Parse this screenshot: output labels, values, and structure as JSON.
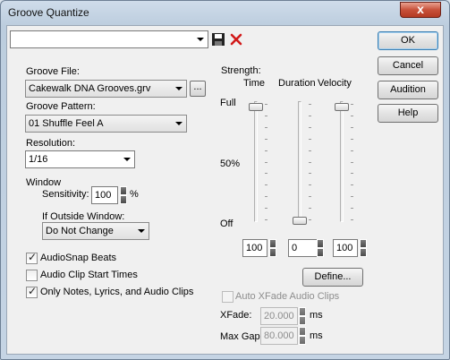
{
  "window": {
    "title": "Groove Quantize",
    "close_glyph": "x"
  },
  "preset": {
    "value": "",
    "save_icon": "save-icon",
    "delete_icon": "delete-icon"
  },
  "buttons": {
    "ok": "OK",
    "cancel": "Cancel",
    "audition": "Audition",
    "help": "Help",
    "define": "Define...",
    "browse": "..."
  },
  "groove_file": {
    "label": "Groove File:",
    "value": "Cakewalk DNA Grooves.grv"
  },
  "groove_pattern": {
    "label": "Groove Pattern:",
    "value": "01 Shuffle Feel A"
  },
  "resolution": {
    "label": "Resolution:",
    "value": "1/16"
  },
  "window_group": {
    "label": "Window",
    "sensitivity_label": "Sensitivity:",
    "sensitivity_value": "100",
    "sensitivity_unit": "%",
    "outside_label": "If Outside Window:",
    "outside_value": "Do Not Change"
  },
  "checkboxes": [
    {
      "label": "AudioSnap Beats",
      "checked": true
    },
    {
      "label": "Audio Clip Start Times",
      "checked": false
    },
    {
      "label": "Only Notes, Lyrics, and Audio Clips",
      "checked": true
    }
  ],
  "strength": {
    "label": "Strength:",
    "scale_full": "Full",
    "scale_mid": "50%",
    "scale_off": "Off",
    "sliders": [
      {
        "name": "Time",
        "value": "100",
        "level": 1.0
      },
      {
        "name": "Duration",
        "value": "0",
        "level": 0.0
      },
      {
        "name": "Velocity",
        "value": "100",
        "level": 1.0
      }
    ]
  },
  "xfade": {
    "auto_label": "Auto XFade Audio Clips",
    "xfade_label": "XFade:",
    "xfade_value": "20.000",
    "xfade_unit": "ms",
    "maxgap_label": "Max Gap:",
    "maxgap_value": "80.000",
    "maxgap_unit": "ms"
  },
  "colors": {
    "titlebar": "#c5d4e4",
    "dialog_bg": "#f0f0f0",
    "close": "#c8513a",
    "default_button": "#3c7fb1"
  }
}
